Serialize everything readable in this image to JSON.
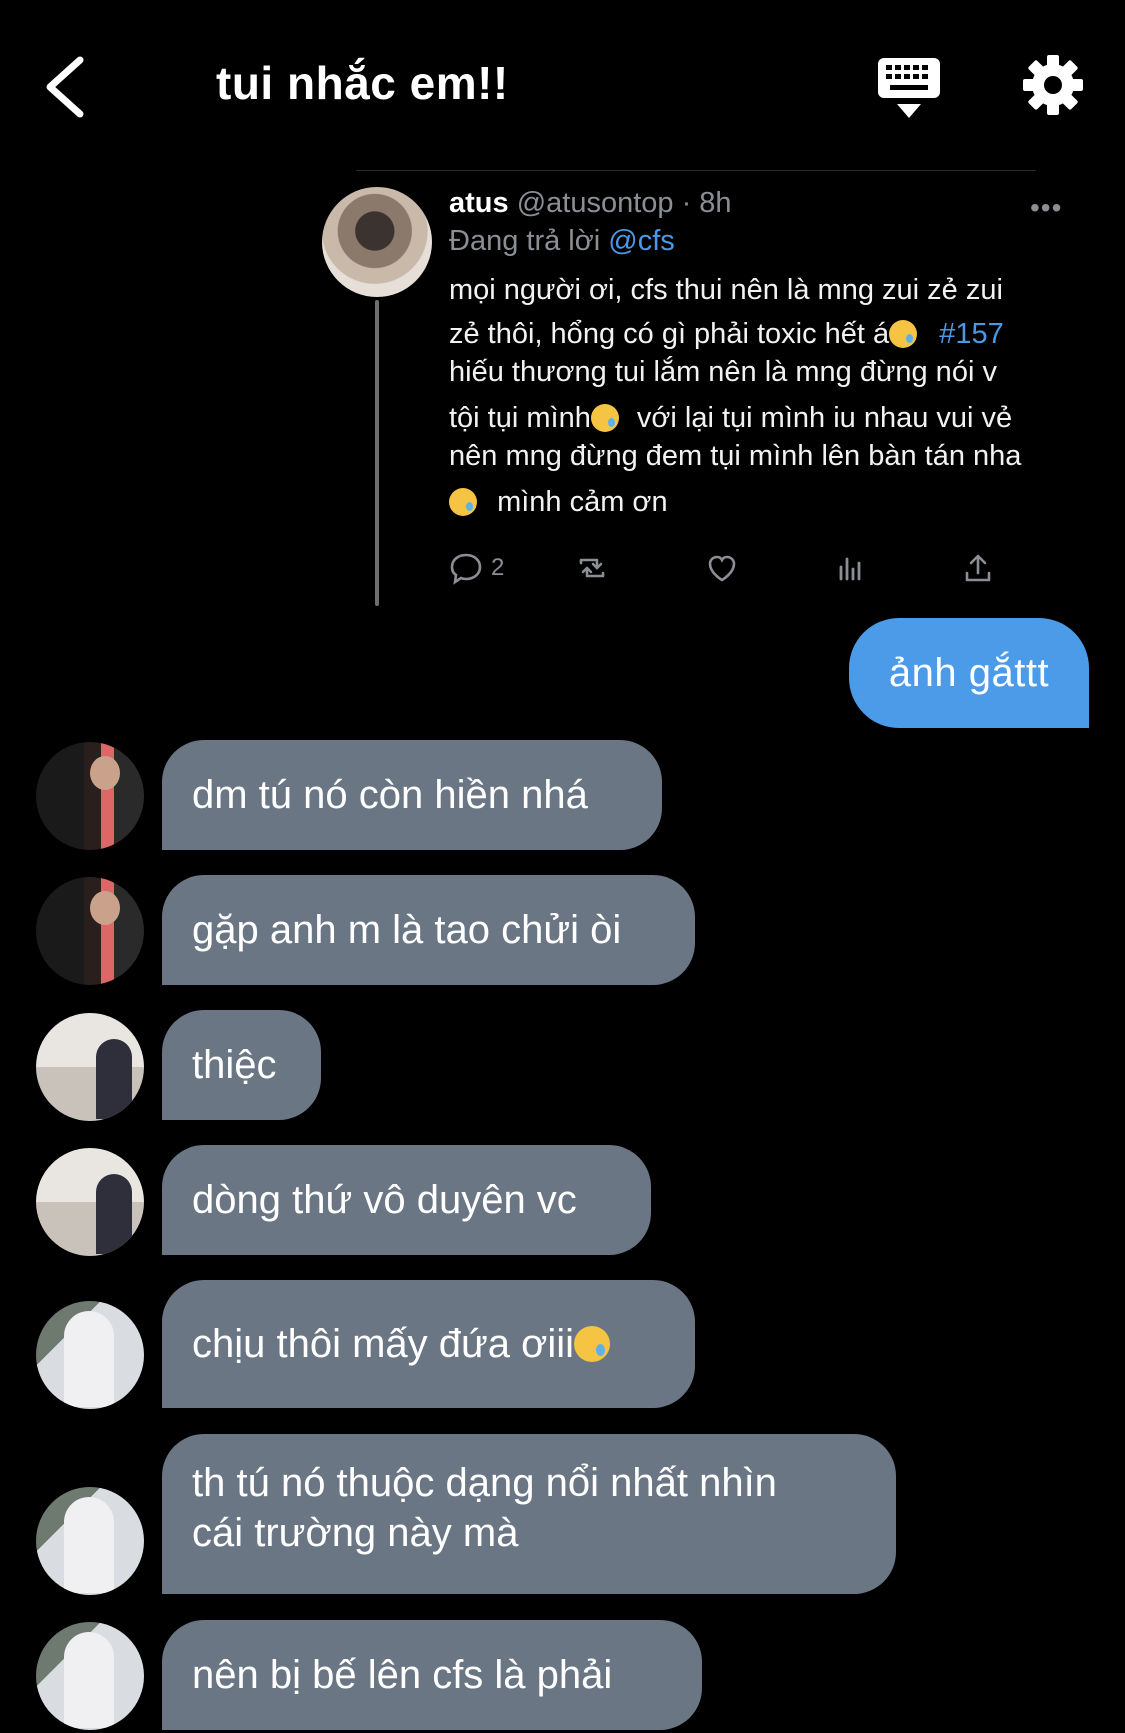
{
  "header": {
    "title": "tui nhắc em!!",
    "back_icon": "chevron-left-icon",
    "keyboard_icon": "keyboard-icon",
    "settings_icon": "gear-icon"
  },
  "tweet": {
    "name": "atus",
    "handle": "@atusontop",
    "time": "· 8h",
    "reply_prefix": "Đang trả lời",
    "reply_to": "@cfs",
    "more": "•••",
    "lines": [
      "mọi người ơi, cfs thui nên là mng zui zẻ zui",
      "zẻ thôi, hổng có gì phải toxic hết á",
      "#157",
      "hiếu thương tui lắm nên là mng đừng nói v",
      "tội tụi mình",
      "với lại tụi mình iu nhau vui vẻ",
      "nên mng đừng đem tụi mình lên bàn tán nha",
      "mình cảm ơn"
    ],
    "reply_count": "2"
  },
  "messages": {
    "sent": "ảnh gắttt",
    "received": [
      "dm tú nó còn hiền nhá",
      "gặp anh m là tao chửi òi",
      "thiệc",
      "dòng thứ vô duyên vc",
      "chịu thôi mấy đứa ơiii",
      "th tú nó thuộc dạng nổi nhất nhìn",
      "cái trường này mà",
      "nên bị bế lên cfs là phải"
    ]
  },
  "colors": {
    "background": "#000000",
    "sent_bubble": "#4c9be8",
    "received_bubble": "#6b7685",
    "link": "#4a98e6",
    "muted": "#8b8f95"
  }
}
